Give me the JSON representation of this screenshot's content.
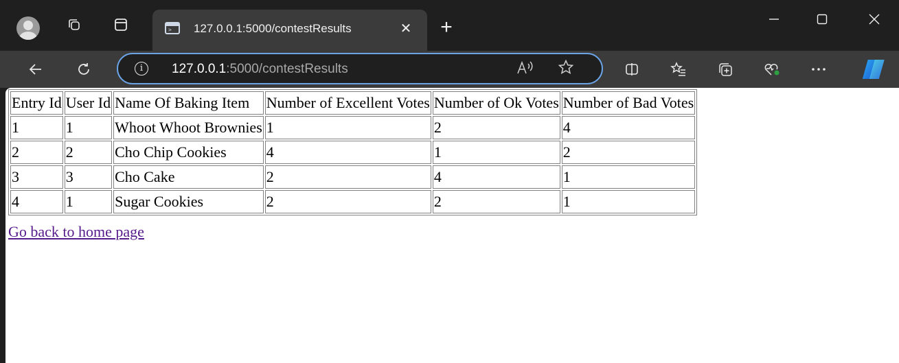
{
  "browser": {
    "tab": {
      "title": "127.0.0.1:5000/contestResults",
      "icon": "terminal-page-icon",
      "close_glyph": "✕"
    },
    "new_tab_glyph": "+",
    "window_controls": [
      "minimize-icon",
      "maximize-icon",
      "close-icon"
    ],
    "address": {
      "host": "127.0.0.1",
      "rest": ":5000/contestResults",
      "info_glyph": "i"
    },
    "toolbar_icons": [
      "back-icon",
      "refresh-icon",
      "split-screen-icon",
      "favorites-icon",
      "collections-icon",
      "browser-essentials-icon",
      "more-icon",
      "copilot-icon"
    ]
  },
  "page": {
    "table": {
      "headers": [
        "Entry Id",
        "User Id",
        "Name Of Baking Item",
        "Number of Excellent Votes",
        "Number of Ok Votes",
        "Number of Bad Votes"
      ],
      "rows": [
        [
          "1",
          "1",
          "Whoot Whoot Brownies",
          "1",
          "2",
          "4"
        ],
        [
          "2",
          "2",
          "Cho Chip Cookies",
          "4",
          "1",
          "2"
        ],
        [
          "3",
          "3",
          "Cho Cake",
          "2",
          "4",
          "1"
        ],
        [
          "4",
          "1",
          "Sugar Cookies",
          "2",
          "2",
          "1"
        ]
      ]
    },
    "home_link": "Go back to home page"
  },
  "colors": {
    "chrome_dark": "#1f1f1f",
    "chrome_mid": "#3b3b3b",
    "omnibox_border": "#6aa3e6",
    "visited_link": "#551a8b"
  }
}
